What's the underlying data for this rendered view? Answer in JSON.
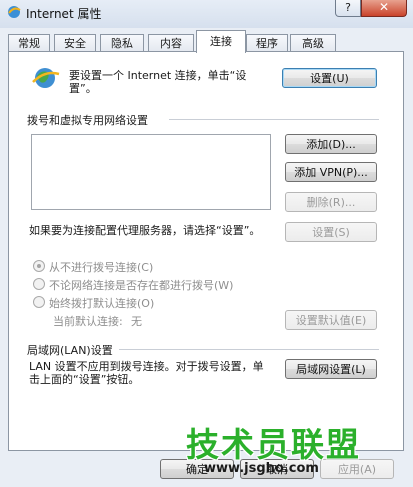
{
  "window": {
    "title": "Internet 属性",
    "help_label": "?",
    "close_label": "✕"
  },
  "tabs": [
    "常规",
    "安全",
    "隐私",
    "内容",
    "连接",
    "程序",
    "高级"
  ],
  "active_tab": "连接",
  "setup": {
    "text": "要设置一个 Internet 连接，单击“设置”。",
    "button": "设置(U)"
  },
  "dialup": {
    "section_title": "拨号和虚拟专用网络设置",
    "add_button": "添加(D)...",
    "add_vpn_button": "添加 VPN(P)...",
    "remove_button": "删除(R)...",
    "proxy_text": "如果要为连接配置代理服务器，请选择“设置”。",
    "settings_button": "设置(S)",
    "radios": [
      {
        "label": "从不进行拨号连接(C)",
        "checked": true
      },
      {
        "label": "不论网络连接是否存在都进行拨号(W)",
        "checked": false
      },
      {
        "label": "始终拨打默认连接(O)",
        "checked": false
      }
    ],
    "current_default_label": "当前默认连接:",
    "current_default_value": "无",
    "set_default_button": "设置默认值(E)"
  },
  "lan": {
    "section_title": "局域网(LAN)设置",
    "text": "LAN 设置不应用到拨号连接。对于拨号设置，单击上面的“设置”按钮。",
    "button": "局域网设置(L)"
  },
  "bottom_buttons": [
    "确定",
    "取消",
    "应用(A)"
  ],
  "watermark": {
    "title": "技术员联盟",
    "url": "www.jsgho.com"
  }
}
